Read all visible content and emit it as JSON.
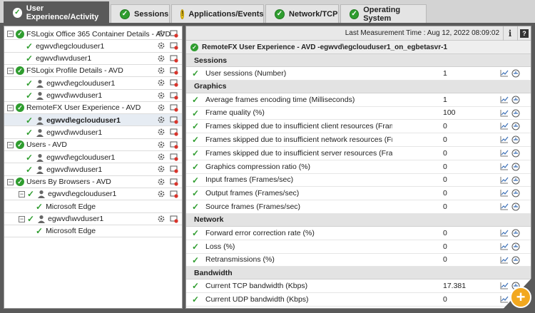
{
  "tabs": [
    {
      "label": "User Experience/Activity",
      "status": "ok",
      "active": true
    },
    {
      "label": "Sessions",
      "status": "ok"
    },
    {
      "label": "Applications/Events",
      "status": "warn"
    },
    {
      "label": "Network/TCP",
      "status": "ok"
    },
    {
      "label": "Operating System",
      "status": "ok"
    }
  ],
  "tree": [
    {
      "label": "FSLogix Office 365 Container Details - AVD",
      "type": "group"
    },
    {
      "label": "egwvd\\egclouduser1",
      "type": "item"
    },
    {
      "label": "egwvd\\wvduser1",
      "type": "item"
    },
    {
      "label": "FSLogix Profile Details - AVD",
      "type": "group"
    },
    {
      "label": "egwvd\\egclouduser1",
      "type": "user"
    },
    {
      "label": "egwvd\\wvduser1",
      "type": "user"
    },
    {
      "label": "RemoteFX User Experience - AVD",
      "type": "group"
    },
    {
      "label": "egwvd\\egclouduser1",
      "type": "user",
      "selected": true
    },
    {
      "label": "egwvd\\wvduser1",
      "type": "user"
    },
    {
      "label": "Users - AVD",
      "type": "group"
    },
    {
      "label": "egwvd\\egclouduser1",
      "type": "user"
    },
    {
      "label": "egwvd\\wvduser1",
      "type": "user"
    },
    {
      "label": "Users By Browsers - AVD",
      "type": "group"
    },
    {
      "label": "egwvd\\egclouduser1",
      "type": "subuser"
    },
    {
      "label": "Microsoft Edge",
      "type": "leaf"
    },
    {
      "label": "egwvd\\wvduser1",
      "type": "subuser"
    },
    {
      "label": "Microsoft Edge",
      "type": "leaf"
    }
  ],
  "panel": {
    "last_measurement": "Last Measurement Time : Aug 12, 2022 08:09:02",
    "info_btn": "i",
    "help_btn": "?",
    "title": "RemoteFX User Experience - AVD -egwvd\\egclouduser1_on_egbetasvr-1",
    "sections": [
      {
        "name": "Sessions",
        "rows": [
          {
            "name": "User sessions (Number)",
            "value": "1"
          }
        ]
      },
      {
        "name": "Graphics",
        "rows": [
          {
            "name": "Average frames encoding time (Milliseconds)",
            "value": "1"
          },
          {
            "name": "Frame quality (%)",
            "value": "100"
          },
          {
            "name": "Frames skipped due to insufficient client resources (Frames/sec)",
            "value": "0"
          },
          {
            "name": "Frames skipped due to insufficient network resources (Frames/sec)",
            "value": "0"
          },
          {
            "name": "Frames skipped due to insufficient server resources (Frames/sec)",
            "value": "0"
          },
          {
            "name": "Graphics compression ratio (%)",
            "value": "0"
          },
          {
            "name": "Input frames (Frames/sec)",
            "value": "0"
          },
          {
            "name": "Output frames (Frames/sec)",
            "value": "0"
          },
          {
            "name": "Source frames (Frames/sec)",
            "value": "0"
          }
        ]
      },
      {
        "name": "Network",
        "rows": [
          {
            "name": "Forward error correction rate (%)",
            "value": "0"
          },
          {
            "name": "Loss (%)",
            "value": "0"
          },
          {
            "name": "Retransmissions (%)",
            "value": "0"
          }
        ]
      },
      {
        "name": "Bandwidth",
        "rows": [
          {
            "name": "Current TCP bandwidth (Kbps)",
            "value": "17.381"
          },
          {
            "name": "Current UDP bandwidth (Kbps)",
            "value": "0"
          }
        ]
      }
    ]
  },
  "fab_label": "+",
  "colors": {
    "ok": "#2f9d2f",
    "warn": "#e6c41e",
    "active_tab": "#5a5a5a",
    "fab": "#f2a81f"
  }
}
